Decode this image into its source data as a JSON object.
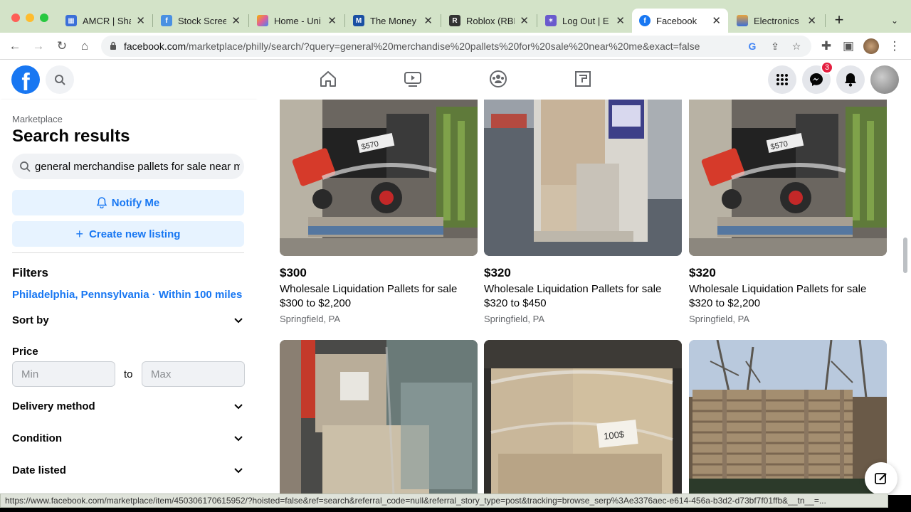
{
  "browser": {
    "tabs": [
      {
        "title": "AMCR | Sha",
        "icon": "grid-app-icon",
        "color": "#3b6fd8"
      },
      {
        "title": "Stock Scree",
        "icon": "chart-app-icon",
        "color": "#4a90e2"
      },
      {
        "title": "Home - Uni",
        "icon": "unicorn-icon",
        "color": "#e05f9a"
      },
      {
        "title": "The Money",
        "icon": "money-app-icon",
        "color": "#1a4fa3"
      },
      {
        "title": "Roblox (RBL",
        "icon": "roblox-icon",
        "color": "#333333"
      },
      {
        "title": "Log Out | E",
        "icon": "star-app-icon",
        "color": "#6a5acd"
      },
      {
        "title": "Facebook",
        "icon": "facebook-icon",
        "color": "#1877f2"
      },
      {
        "title": "Electronics",
        "icon": "electronics-icon",
        "color": "#e8a33d"
      }
    ],
    "active_tab": 6,
    "url_domain": "facebook.com",
    "url_path": "/marketplace/philly/search/?query=general%20merchandise%20pallets%20for%20sale%20near%20me&exact=false",
    "status_url": "https://www.facebook.com/marketplace/item/450306170615952/?hoisted=false&ref=search&referral_code=null&referral_story_type=post&tracking=browse_serp%3Ae3376aec-e614-456a-b3d2-d73bf7f01ffb&__tn__=..."
  },
  "fb": {
    "messenger_badge": "3",
    "accent": "#1877f2"
  },
  "sidebar": {
    "crumb": "Marketplace",
    "title": "Search results",
    "query": "general merchandise pallets for sale near me",
    "notify_label": "Notify Me",
    "create_label": "Create new listing",
    "filters_heading": "Filters",
    "location": "Philadelphia, Pennsylvania · Within 100 miles",
    "sort_by": "Sort by",
    "price_label": "Price",
    "min_placeholder": "Min",
    "to": "to",
    "max_placeholder": "Max",
    "delivery": "Delivery method",
    "condition": "Condition",
    "date_listed": "Date listed"
  },
  "listings": [
    {
      "price": "$300",
      "title": "Wholesale Liquidation Pallets for sale",
      "range": "$300 to $2,200",
      "location": "Springfield, PA"
    },
    {
      "price": "$320",
      "title": "Wholesale Liquidation Pallets for sale",
      "range": "$320 to $450",
      "location": "Springfield, PA"
    },
    {
      "price": "$320",
      "title": "Wholesale Liquidation Pallets for sale",
      "range": "$320 to $2,200",
      "location": "Springfield, PA"
    }
  ],
  "photo_tags": {
    "tag1": "$570",
    "tag2": "100$"
  }
}
